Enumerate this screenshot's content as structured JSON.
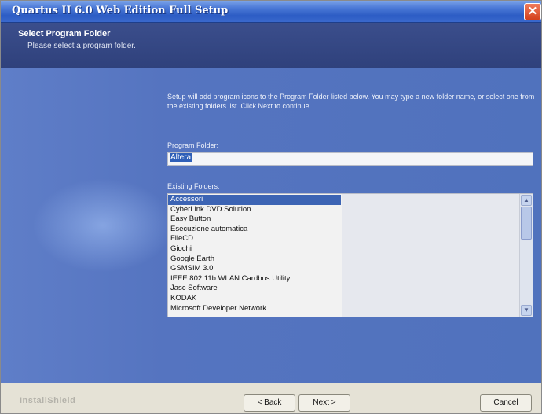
{
  "window": {
    "title": "Quartus II 6.0 Web Edition Full Setup",
    "close_symbol": "✕"
  },
  "header": {
    "title": "Select Program Folder",
    "subtitle": "Please select a program folder."
  },
  "main": {
    "instructions": "Setup will add program icons to the Program Folder listed below. You may type a new folder name, or select one from the existing folders list. Click Next to continue.",
    "program_folder_label": "Program Folder:",
    "program_folder_value": "Altera",
    "existing_folders_label": "Existing Folders:",
    "existing_folders": [
      "Accessori",
      "CyberLink DVD Solution",
      "Easy Button",
      "Esecuzione automatica",
      "FileCD",
      "Giochi",
      "Google Earth",
      "GSMSIM 3.0",
      "IEEE 802.11b WLAN Cardbus Utility",
      "Jasc Software",
      "KODAK",
      "Microsoft Developer Network"
    ],
    "selected_folder_index": 0
  },
  "footer": {
    "brand": "InstallShield",
    "back_label": "< Back",
    "next_label": "Next >",
    "cancel_label": "Cancel"
  },
  "icons": {
    "scroll_up": "up-arrow-icon",
    "scroll_down": "down-arrow-icon",
    "close": "close-icon"
  }
}
